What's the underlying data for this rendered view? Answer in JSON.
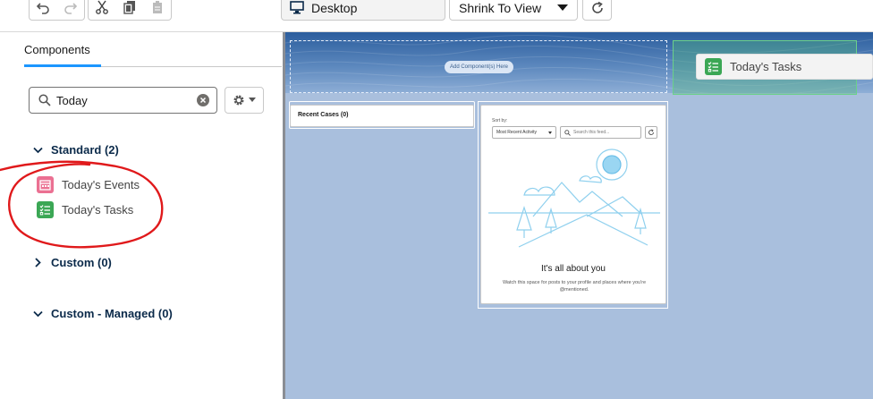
{
  "toolbar": {
    "undo": "undo-icon",
    "redo": "redo-icon",
    "cut": "cut-icon",
    "copy": "copy-icon",
    "paste": "paste-icon",
    "device_label": "Desktop",
    "zoom_value": "Shrink To View",
    "refresh": "refresh-icon"
  },
  "panel": {
    "tab_label": "Components",
    "search": {
      "value": "Today"
    },
    "sections": [
      {
        "label": "Standard (2)",
        "expanded": true,
        "items": [
          {
            "label": "Today's Events",
            "icon": "calendar-icon",
            "color": "#eb7092"
          },
          {
            "label": "Today's Tasks",
            "icon": "task-list-icon",
            "color": "#3ba755"
          }
        ]
      },
      {
        "label": "Custom (0)",
        "expanded": false
      },
      {
        "label": "Custom - Managed (0)",
        "expanded": true
      }
    ]
  },
  "canvas": {
    "header_drop_label": "Add Component(s) Here",
    "drag_ghost_label": "Today's Tasks",
    "recent_cases_label": "Recent Cases (0)",
    "feed": {
      "sort_by_label": "Sort by:",
      "sort_value": "Most Recent Activity",
      "search_placeholder": "Search this feed...",
      "empty_title": "It's all about you",
      "empty_desc": "Watch this space for posts to your profile and places where you're @mentioned."
    }
  },
  "colors": {
    "accent": "#1b96ff",
    "canvas_bg": "#a9bfdd",
    "drop_highlight": "#4cb976",
    "annotation": "#e0191b"
  }
}
